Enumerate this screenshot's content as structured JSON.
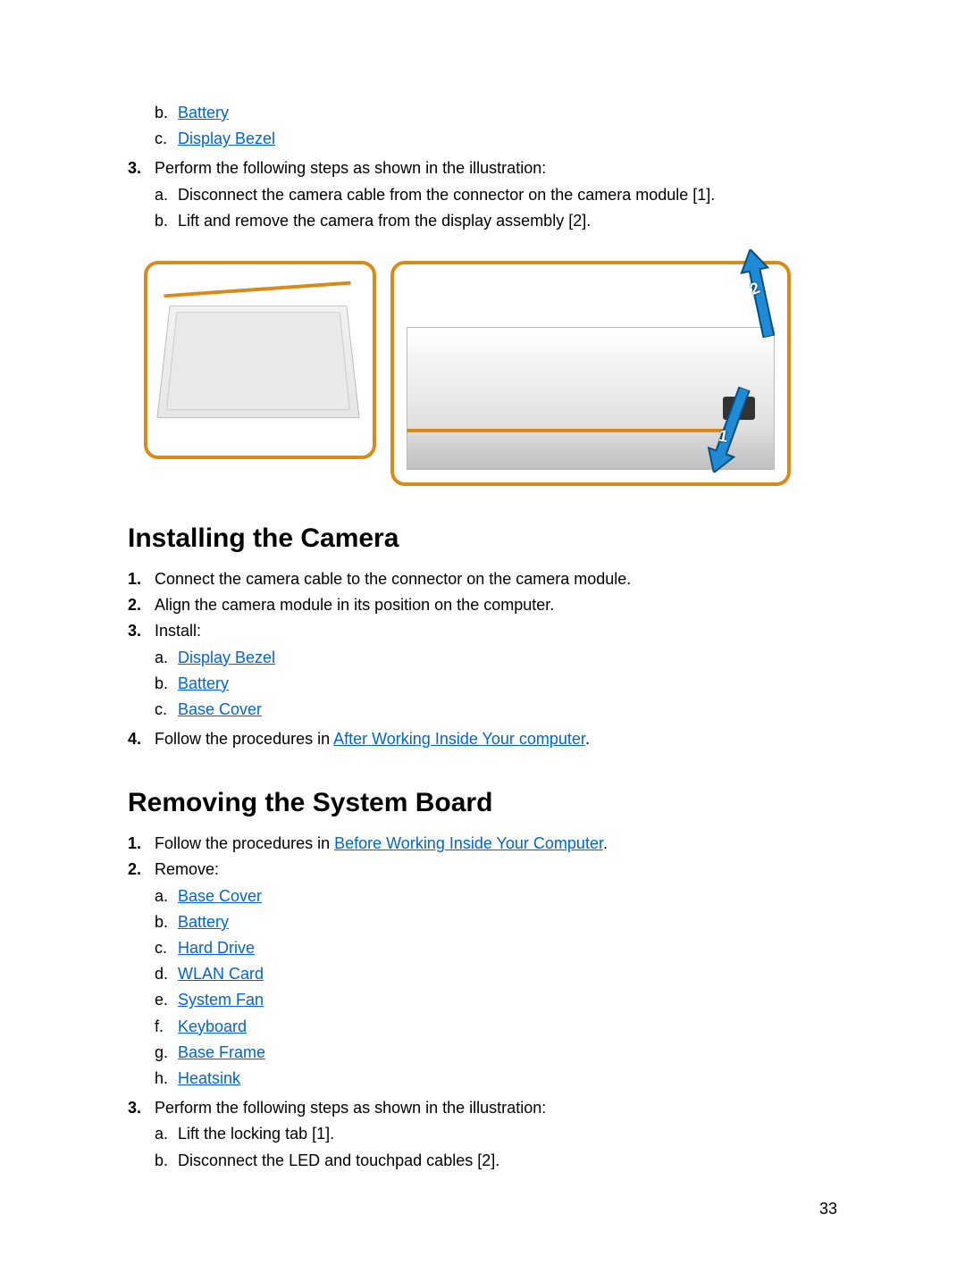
{
  "page_number": "33",
  "top_list": {
    "alpha_continued": [
      {
        "letter": "b.",
        "link": "Battery"
      },
      {
        "letter": "c.",
        "link": "Display Bezel"
      }
    ],
    "step3": {
      "num": "3.",
      "text": "Perform the following steps as shown in the illustration:",
      "sub": [
        {
          "letter": "a.",
          "text": "Disconnect the camera cable from the connector on the camera module [1]."
        },
        {
          "letter": "b.",
          "text": "Lift and remove the camera from the display assembly [2]."
        }
      ]
    }
  },
  "figure": {
    "callout1": "1",
    "callout2": "2"
  },
  "section_install": {
    "heading": "Installing the Camera",
    "steps": [
      {
        "num": "1.",
        "text": "Connect the camera cable to the connector on the camera module."
      },
      {
        "num": "2.",
        "text": "Align the camera module in its position on the computer."
      },
      {
        "num": "3.",
        "text": "Install:",
        "sub": [
          {
            "letter": "a.",
            "link": "Display Bezel"
          },
          {
            "letter": "b.",
            "link": "Battery"
          },
          {
            "letter": "c.",
            "link": "Base Cover"
          }
        ]
      },
      {
        "num": "4.",
        "text_before": "Follow the procedures in ",
        "link": "After Working Inside Your computer",
        "text_after": "."
      }
    ]
  },
  "section_remove": {
    "heading": "Removing the System Board",
    "steps": [
      {
        "num": "1.",
        "text_before": "Follow the procedures in ",
        "link": "Before Working Inside Your Computer",
        "text_after": "."
      },
      {
        "num": "2.",
        "text": "Remove:",
        "sub": [
          {
            "letter": "a.",
            "link": "Base Cover"
          },
          {
            "letter": "b.",
            "link": "Battery"
          },
          {
            "letter": "c.",
            "link": "Hard Drive"
          },
          {
            "letter": "d.",
            "link": "WLAN Card"
          },
          {
            "letter": "e.",
            "link": "System Fan"
          },
          {
            "letter": "f.",
            "link": "Keyboard"
          },
          {
            "letter": "g.",
            "link": "Base Frame"
          },
          {
            "letter": "h.",
            "link": "Heatsink"
          }
        ]
      },
      {
        "num": "3.",
        "text": "Perform the following steps as shown in the illustration:",
        "sub_plain": [
          {
            "letter": "a.",
            "text": "Lift the locking tab [1]."
          },
          {
            "letter": "b.",
            "text": "Disconnect the LED and touchpad cables [2]."
          }
        ]
      }
    ]
  }
}
